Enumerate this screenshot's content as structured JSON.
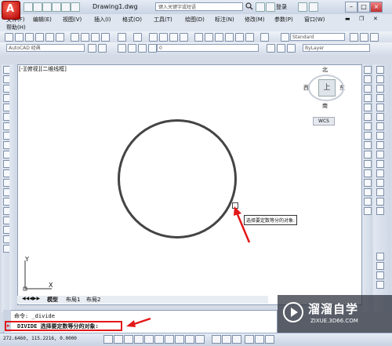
{
  "title_bar": {
    "document": "Drawing1.dwg",
    "search_placeholder": "键入关键字或短语",
    "login": "登录"
  },
  "menu": {
    "row1": [
      "文件(F)",
      "编辑(E)",
      "视图(V)",
      "插入(I)",
      "格式(O)",
      "工具(T)",
      "绘图(D)",
      "标注(N)",
      "修改(M)",
      "参数(P)",
      "窗口(W)"
    ],
    "row2": [
      "帮助(H)"
    ]
  },
  "toolbar": {
    "text_style": "Standard",
    "workspace": "AutoCAD 经典",
    "layer_value": "0",
    "color_value": "ByLayer"
  },
  "viewport": {
    "label": "[-][俯视][二维线框]",
    "tooltip": "选择要定数等分的对象:"
  },
  "viewcube": {
    "north": "北",
    "south": "南",
    "east": "东",
    "west": "西",
    "top": "上",
    "wcs": "WCS"
  },
  "ucs": {
    "y": "Y",
    "x": "X"
  },
  "tabs": [
    "模型",
    "布局1",
    "布局2"
  ],
  "command": {
    "history": "命令:  _divide",
    "prompt_cmd": "DIVIDE",
    "prompt_text": "选择要定数等分的对象:"
  },
  "status": {
    "coords": "272.6460, 115.2216, 0.0000"
  },
  "watermark": {
    "name": "溜溜自学",
    "url": "ZIXUE.3D66.COM"
  },
  "colors": {
    "highlight": "#e31818",
    "accent": "#b00000"
  }
}
